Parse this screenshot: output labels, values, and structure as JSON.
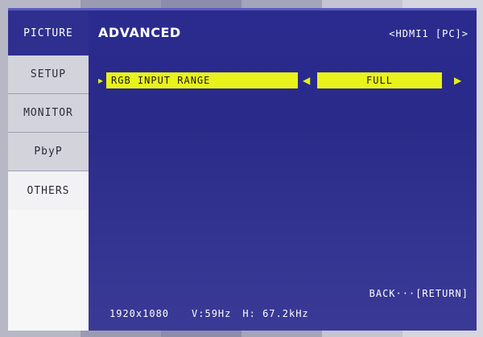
{
  "nav": {
    "items": [
      {
        "label": "PICTURE",
        "active": true
      },
      {
        "label": "SETUP",
        "active": false
      },
      {
        "label": "MONITOR",
        "active": false
      },
      {
        "label": "PbyP",
        "active": false
      },
      {
        "label": "OTHERS",
        "active": false
      }
    ]
  },
  "header": {
    "title": "ADVANCED",
    "source": "<HDMI1 [PC]>"
  },
  "setting": {
    "label": "RGB INPUT RANGE",
    "value": "FULL"
  },
  "footer": {
    "back": "BACK···[RETURN]"
  },
  "status": {
    "resolution": "1920x1080",
    "vfreq": "V:59Hz",
    "hfreq": "H: 67.2kHz"
  },
  "colors": {
    "osd_blue": "#2f2f8f",
    "highlight_yellow": "#e9f21a"
  }
}
